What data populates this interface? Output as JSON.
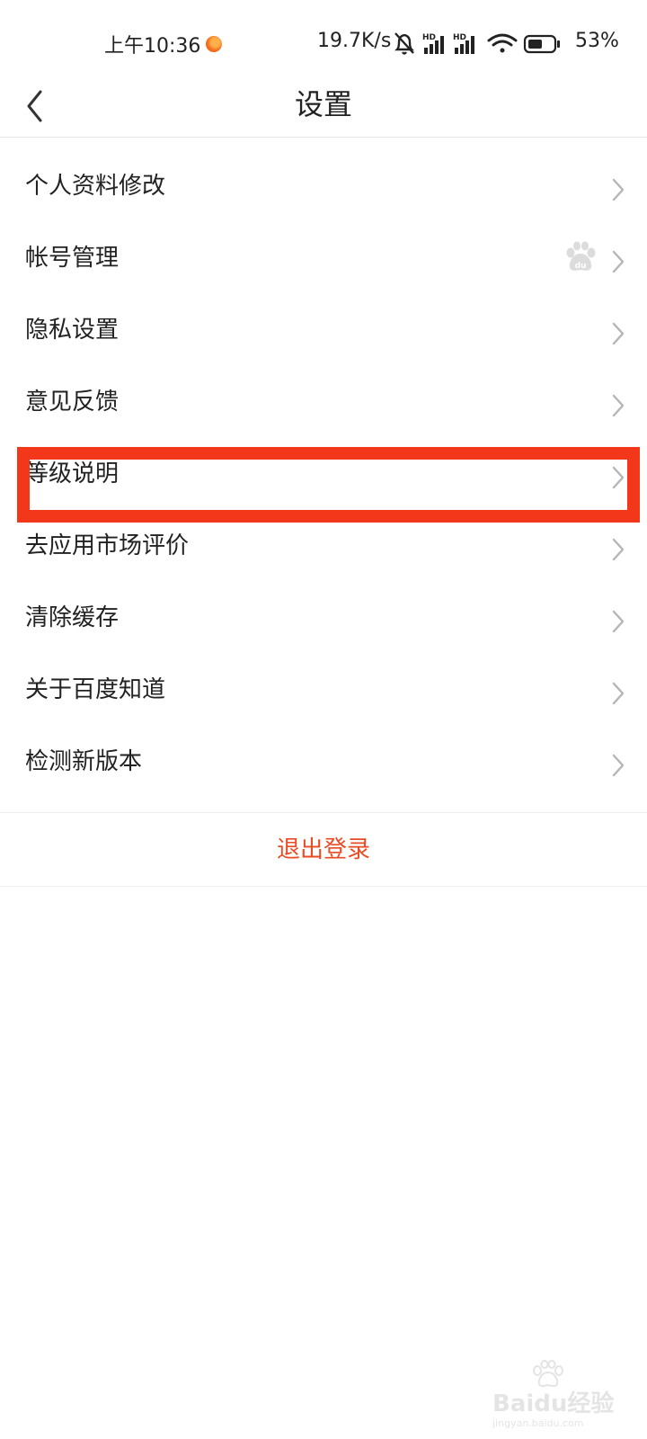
{
  "status_bar": {
    "time": "上午10:36",
    "net_speed": "19.7K/s",
    "battery": "53%",
    "icons": [
      "notification-dot-icon",
      "mute-icon",
      "signal-hd-icon",
      "signal-hd-icon",
      "wifi-icon",
      "battery-icon"
    ]
  },
  "header": {
    "title": "设置"
  },
  "settings": {
    "items": [
      {
        "label": "个人资料修改"
      },
      {
        "label": "帐号管理"
      },
      {
        "label": "隐私设置"
      },
      {
        "label": "意见反馈"
      },
      {
        "label": "等级说明"
      },
      {
        "label": "去应用市场评价"
      },
      {
        "label": "清除缓存"
      },
      {
        "label": "关于百度知道"
      },
      {
        "label": "检测新版本"
      }
    ]
  },
  "logout": {
    "label": "退出登录"
  },
  "colors": {
    "accent": "#e94b25",
    "highlight": "#f2371b",
    "divider": "#eeeeee"
  },
  "watermark": {
    "text": "Baidu经验",
    "sub": "jingyan.baidu.com"
  }
}
